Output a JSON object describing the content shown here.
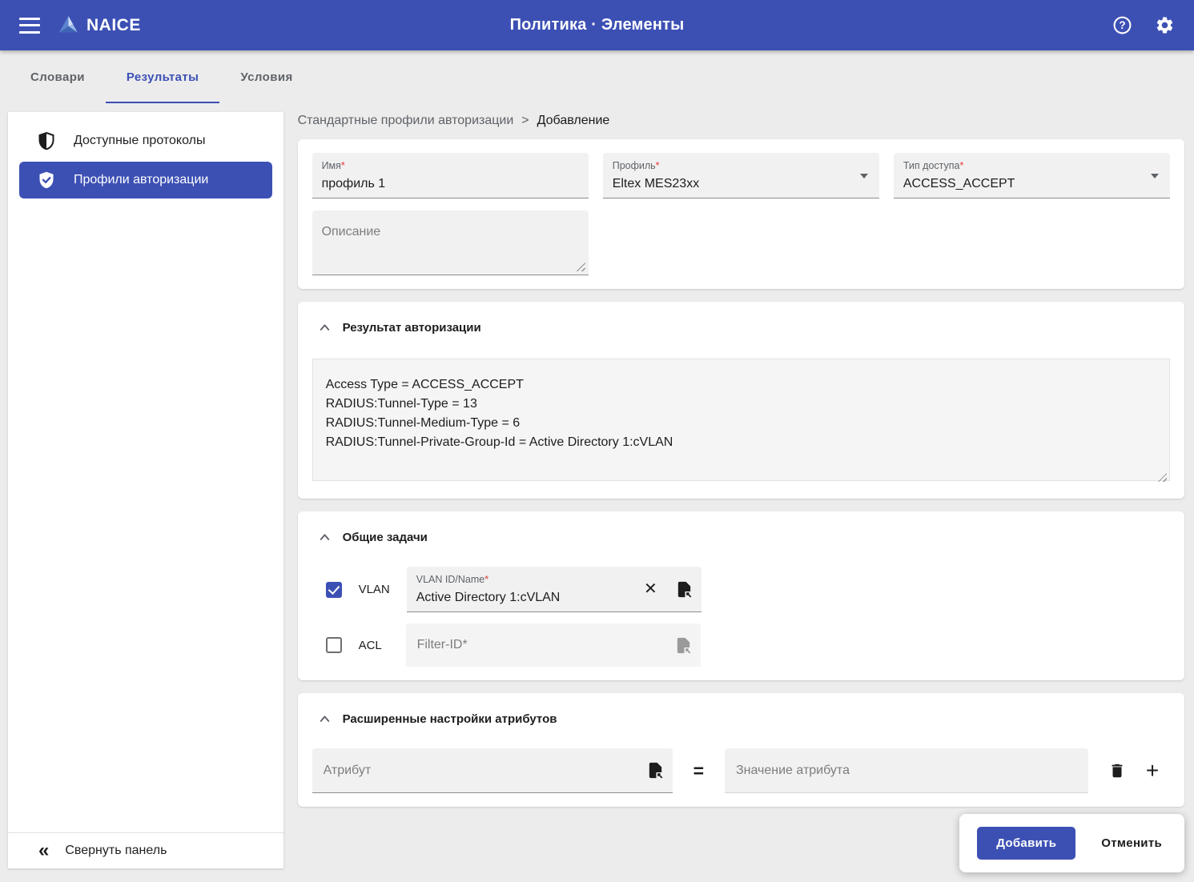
{
  "colors": {
    "primary": "#3c50b4",
    "required_red": "#e53935",
    "page_background": "#ececec"
  },
  "app_bar": {
    "brand": "NAICE",
    "title": "Политика · Элементы"
  },
  "icons": {
    "help_glyph": "?",
    "close": "✕",
    "plus": "+",
    "equals": "=",
    "collapse": "«",
    "breadcrumb_separator": ">"
  },
  "tabs": [
    {
      "label": "Словари",
      "active": false
    },
    {
      "label": "Результаты",
      "active": true
    },
    {
      "label": "Условия",
      "active": false
    }
  ],
  "sidebar": {
    "items": [
      {
        "label": "Доступные протоколы",
        "selected": false
      },
      {
        "label": "Профили авторизации",
        "selected": true
      }
    ],
    "collapse_label": "Свернуть панель"
  },
  "breadcrumb": {
    "parent": "Стандартные профили авторизации",
    "current": "Добавление"
  },
  "profile_form": {
    "name": {
      "label": "Имя",
      "required_mark": "*",
      "value": "профиль 1"
    },
    "profile": {
      "label": "Профиль",
      "required_mark": "*",
      "value": "Eltex MES23xx"
    },
    "access_type": {
      "label": "Тип доступа",
      "required_mark": "*",
      "value": "ACCESS_ACCEPT"
    },
    "description": {
      "placeholder": "Описание"
    }
  },
  "auth_result": {
    "title": "Результат авторизации",
    "content": "Access Type = ACCESS_ACCEPT\nRADIUS:Tunnel-Type = 13\nRADIUS:Tunnel-Medium-Type = 6\nRADIUS:Tunnel-Private-Group-Id = Active Directory 1:cVLAN"
  },
  "common_tasks": {
    "title": "Общие задачи",
    "vlan": {
      "checkbox_label": "VLAN",
      "checked": true,
      "field_label": "VLAN ID/Name",
      "required_mark": "*",
      "value": "Active Directory 1:cVLAN"
    },
    "acl": {
      "checkbox_label": "ACL",
      "checked": false,
      "placeholder": "Filter-ID*"
    }
  },
  "advanced_attributes": {
    "title": "Расширенные настройки атрибутов",
    "attribute": {
      "placeholder": "Атрибут"
    },
    "value": {
      "placeholder": "Значение атрибута"
    }
  },
  "actions": {
    "submit_label": "Добавить",
    "cancel_label": "Отменить"
  }
}
